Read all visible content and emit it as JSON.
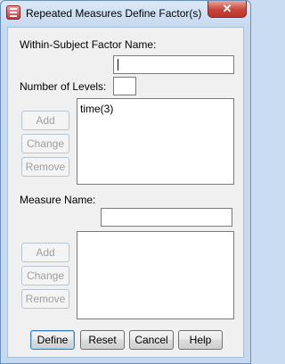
{
  "window": {
    "title": "Repeated Measures Define Factor(s)",
    "close_symbol": "✕"
  },
  "factor": {
    "name_label": "Within-Subject Factor Name:",
    "name_value": "",
    "levels_label": "Number of Levels:",
    "levels_value": "",
    "list_items": [
      "time(3)"
    ],
    "buttons": {
      "add": "Add",
      "change": "Change",
      "remove": "Remove"
    }
  },
  "measure": {
    "name_label": "Measure Name:",
    "name_value": "",
    "list_items": [],
    "buttons": {
      "add": "Add",
      "change": "Change",
      "remove": "Remove"
    }
  },
  "footer": {
    "define": "Define",
    "reset": "Reset",
    "cancel": "Cancel",
    "help": "Help"
  },
  "colors": {
    "title_bar": "#c5d9f0",
    "close_button": "#c8443a",
    "dialog_bg": "#f0f0f0",
    "default_button_border": "#3c7fb1"
  },
  "icons": {
    "app": "spss-dialog-icon",
    "close": "close-icon"
  }
}
